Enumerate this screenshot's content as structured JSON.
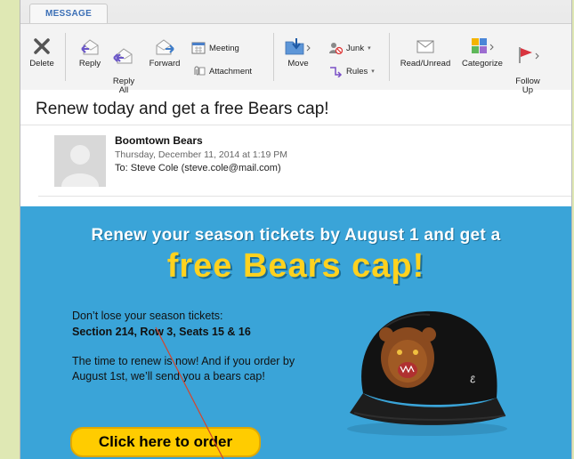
{
  "ribbon": {
    "active_tab": "MESSAGE",
    "buttons": {
      "delete": "Delete",
      "reply": "Reply",
      "reply_all": "Reply\nAll",
      "forward": "Forward",
      "meeting": "Meeting",
      "attachment": "Attachment",
      "move": "Move",
      "junk": "Junk",
      "rules": "Rules",
      "read_unread": "Read/Unread",
      "categorize": "Categorize",
      "follow_up": "Follow\nUp"
    }
  },
  "email": {
    "subject": "Renew today and get a free Bears cap!",
    "sender": "Boomtown Bears",
    "date": "Thursday, December 11, 2014 at 1:19 PM",
    "to": "To: Steve Cole (steve.cole@mail.com)"
  },
  "promo": {
    "headline": "Renew your season tickets by August 1 and get a",
    "headline_big": "free Bears cap!",
    "line1": "Don’t lose your season tickets:",
    "seats": "Section 214, Row 3, Seats 15 & 16",
    "paragraph": "The time to renew is now! And if you order by August 1st, we’ll send you a bears cap!",
    "cta": "Click here to order"
  },
  "colors": {
    "promo_bg": "#3aa4d8",
    "headline_yellow": "#ffd21f",
    "cta_bg": "#ffcc00",
    "tab_accent": "#3b6fb6"
  }
}
